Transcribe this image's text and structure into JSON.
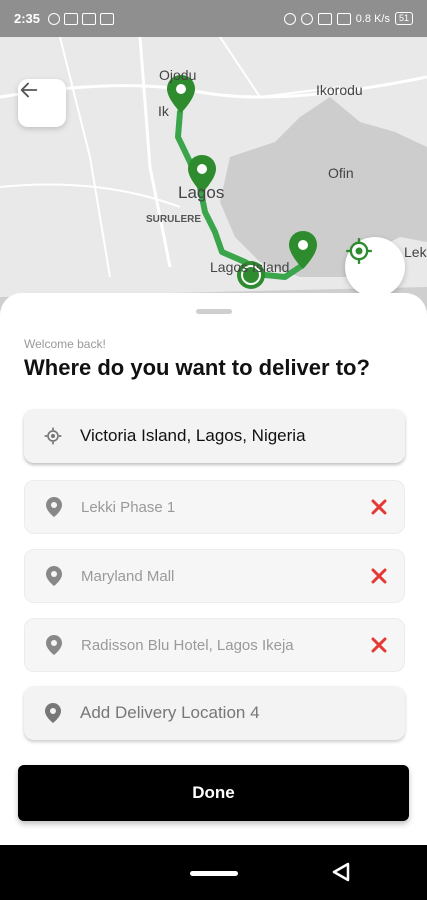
{
  "status_bar": {
    "time": "2:35",
    "speed": "0.8 K/s",
    "battery": "51"
  },
  "map": {
    "labels": [
      {
        "id": "ojodu",
        "text": "Ojodu"
      },
      {
        "id": "ikorodu",
        "text": "Ikorodu"
      },
      {
        "id": "ofin",
        "text": "Ofin"
      },
      {
        "id": "lagos",
        "text": "Lagos"
      },
      {
        "id": "surulere",
        "text": "SURULERE"
      },
      {
        "id": "lagos-island",
        "text": "Lagos Island"
      },
      {
        "id": "lek",
        "text": "Lek"
      },
      {
        "id": "ik",
        "text": "Ik"
      }
    ],
    "route_color": "#3aa54a",
    "pin_color": "#2e8b2e"
  },
  "sheet": {
    "welcome": "Welcome back!",
    "heading": "Where do you want to deliver to?",
    "pickup": "Victoria Island, Lagos, Nigeria",
    "stops": [
      {
        "label": "Lekki Phase 1"
      },
      {
        "label": "Maryland Mall"
      },
      {
        "label": "Radisson Blu Hotel, Lagos Ikeja"
      }
    ],
    "add_location": "Add Delivery Location 4",
    "done": "Done",
    "remove_color": "#e53935"
  }
}
